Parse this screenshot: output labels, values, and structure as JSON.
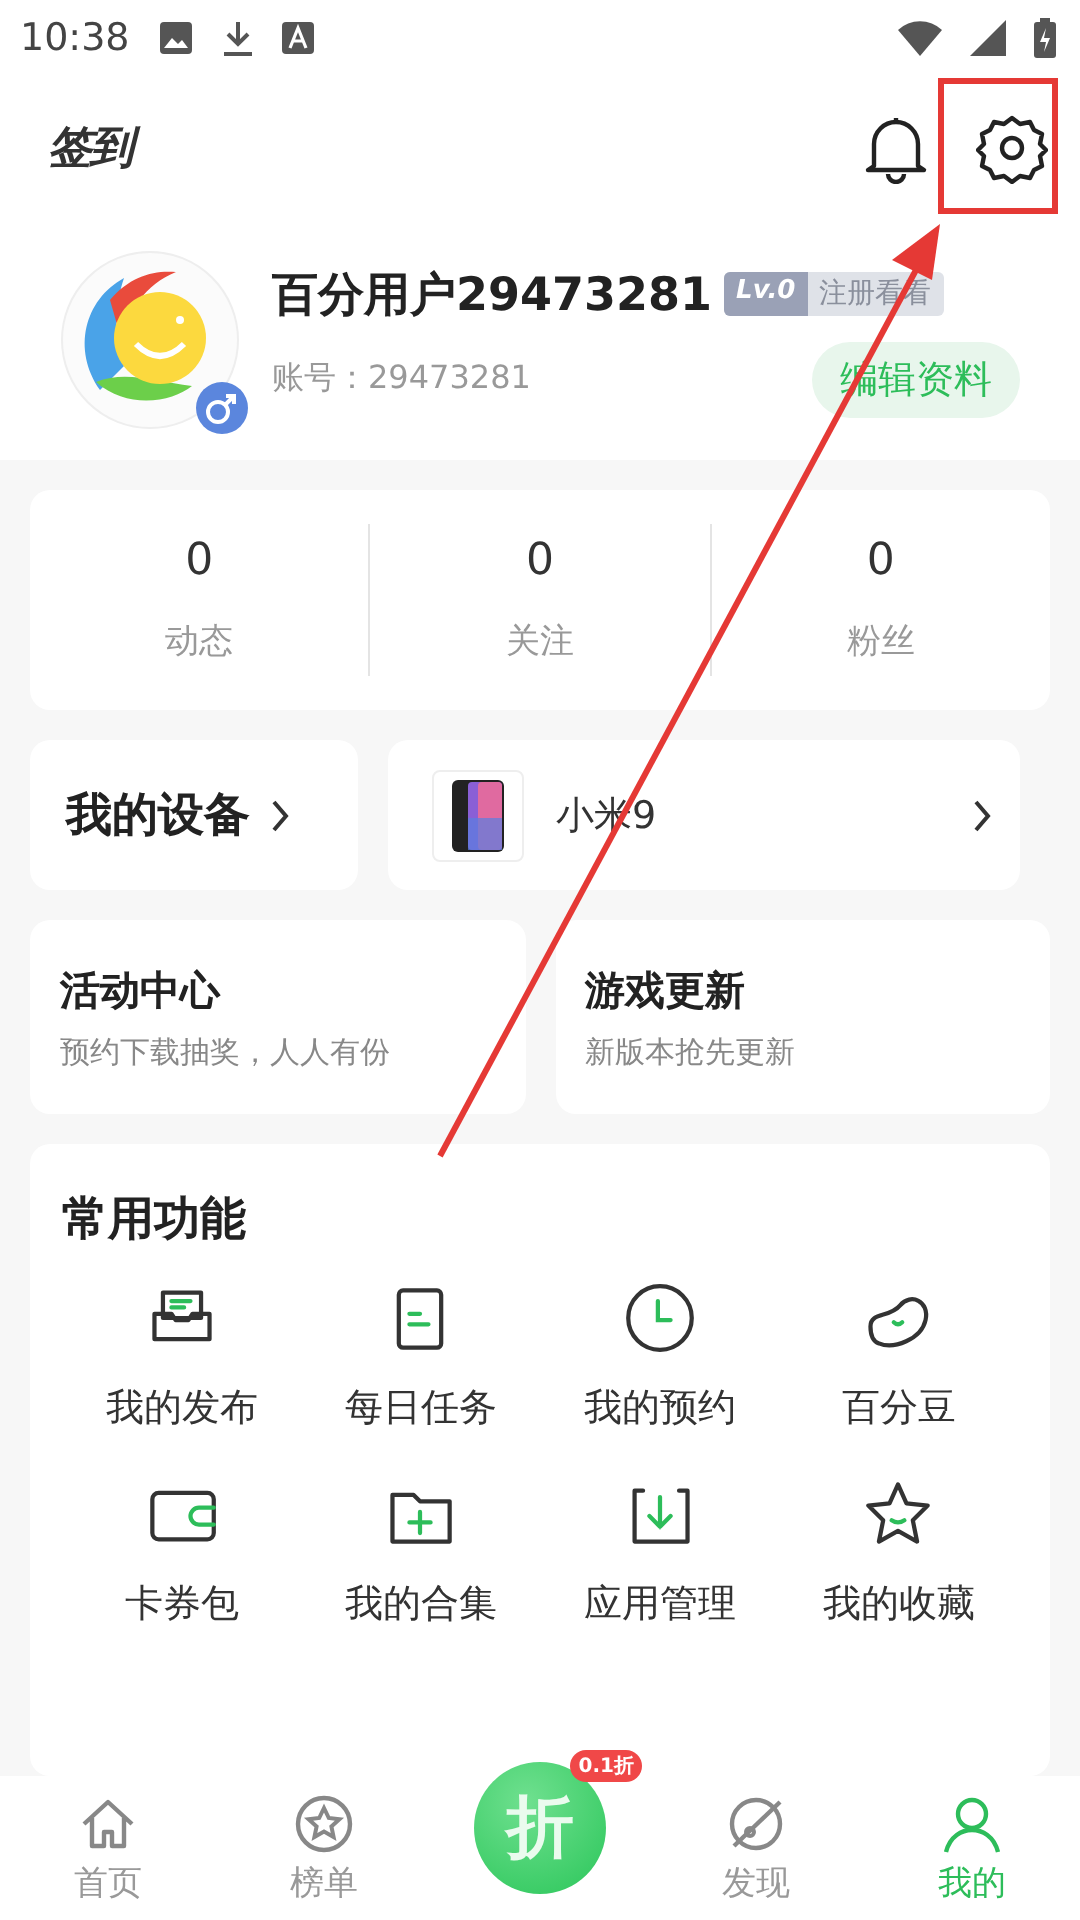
{
  "status_bar": {
    "time": "10:38"
  },
  "header": {
    "logo": "签到"
  },
  "profile": {
    "name": "百分用户29473281",
    "level": "Lv.0",
    "level_hint": "注册看看",
    "account": "账号：29473281",
    "edit_button": "编辑资料"
  },
  "stats": [
    {
      "value": "0",
      "label": "动态"
    },
    {
      "value": "0",
      "label": "关注"
    },
    {
      "value": "0",
      "label": "粉丝"
    }
  ],
  "devices": {
    "title": "我的设备",
    "device": "小米9"
  },
  "promos": [
    {
      "title": "活动中心",
      "subtitle": "预约下载抽奖，人人有份"
    },
    {
      "title": "游戏更新",
      "subtitle": "新版本抢先更新"
    }
  ],
  "functions": {
    "title": "常用功能",
    "items": [
      "我的发布",
      "每日任务",
      "我的预约",
      "百分豆",
      "卡券包",
      "我的合集",
      "应用管理",
      "我的收藏"
    ]
  },
  "tab_bar": {
    "tabs": [
      {
        "label": "首页",
        "selected": false
      },
      {
        "label": "榜单",
        "selected": false
      },
      {
        "label": "发现",
        "selected": false
      },
      {
        "label": "我的",
        "selected": true
      }
    ],
    "center_label": "折",
    "center_badge": "0.1折"
  }
}
